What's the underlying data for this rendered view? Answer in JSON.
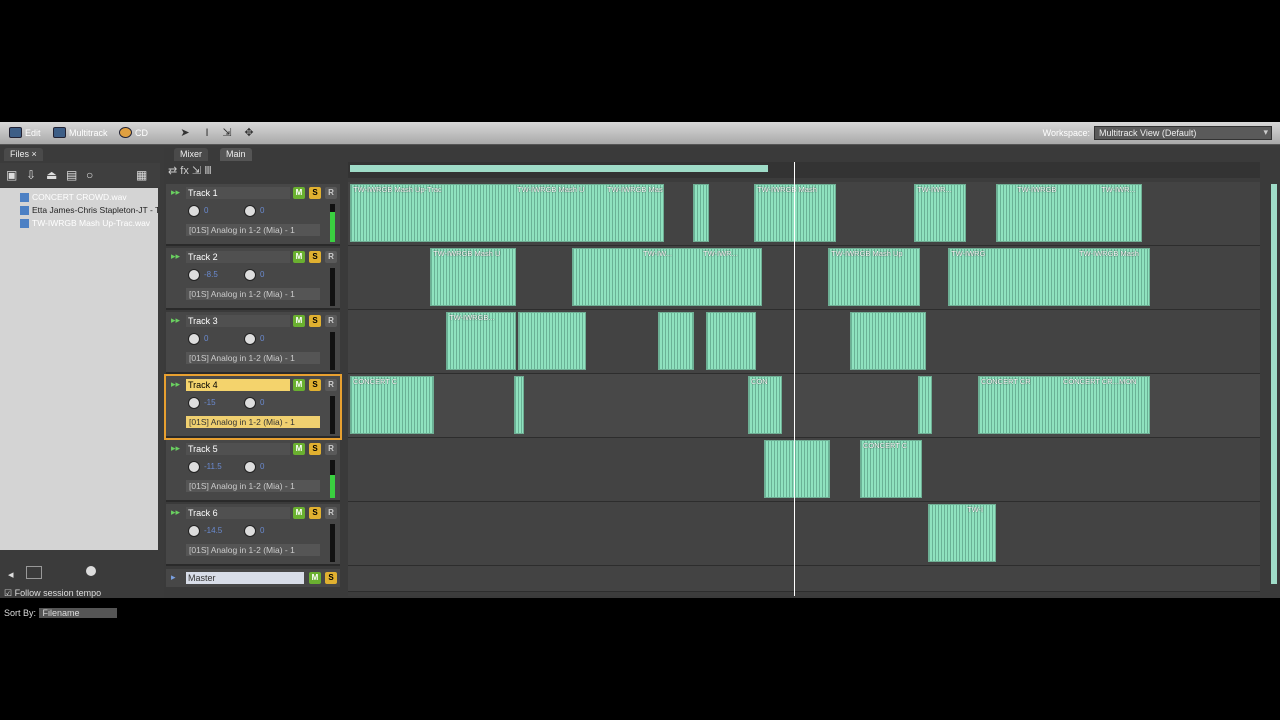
{
  "toolbar": {
    "edit_label": "Edit",
    "multitrack_label": "Multitrack",
    "cd_label": "CD",
    "workspace_label": "Workspace:",
    "workspace_value": "Multitrack View (Default)"
  },
  "files_panel": {
    "tab": "Files",
    "files": [
      "CONCERT CROWD.wav",
      "Etta James-Chris Stapleton-JT - T",
      "TW-IWRGB Mash Up-Trac.wav"
    ],
    "follow_tempo": "Follow session tempo",
    "sort_label": "Sort By:",
    "sort_value": "Filename"
  },
  "tabs": {
    "mixer": "Mixer",
    "main": "Main"
  },
  "tracks": [
    {
      "name": "Track 1",
      "vol": "0",
      "pan": "0",
      "input": "[01S] Analog in 1-2 (Mia) - 1"
    },
    {
      "name": "Track 2",
      "vol": "-8.5",
      "pan": "0",
      "input": "[01S] Analog in 1-2 (Mia) - 1"
    },
    {
      "name": "Track 3",
      "vol": "0",
      "pan": "0",
      "input": "[01S] Analog in 1-2 (Mia) - 1"
    },
    {
      "name": "Track 4",
      "vol": "-15",
      "pan": "0",
      "input": "[01S] Analog in 1-2 (Mia) - 1"
    },
    {
      "name": "Track 5",
      "vol": "-11.5",
      "pan": "0",
      "input": "[01S] Analog in 1-2 (Mia) - 1"
    },
    {
      "name": "Track 6",
      "vol": "-14.5",
      "pan": "0",
      "input": "[01S] Analog in 1-2 (Mia) - 1"
    }
  ],
  "master": {
    "name": "Master"
  },
  "buttons": {
    "m": "M",
    "s": "S",
    "r": "R"
  },
  "clips": {
    "t1a": "TW-IWRGB Mash Up-Trac",
    "t1b": "TW-IWRGB Mash U",
    "t1c": "TW-IWRGB Mash",
    "t1d": "TW-IWRGB Mash",
    "t1e": "TW-IWR...",
    "t1f": "TW-IWRGB",
    "t1g": "TW-IWR...",
    "t2a": "TW-IWRGB Mash U",
    "t2b": "TW-IW...",
    "t2c": "TW-IWR...",
    "t2d": "TW-IWRGB Mash Up",
    "t2e": "TW-IWRG",
    "t2f": "TW-IWRGB Mash",
    "t3a": "TW-IWRGB...",
    "t4a": "CONCERT C",
    "t4b": "CON",
    "t4c": "CONCERT CR",
    "t4d": "CONCERT CR...MON",
    "t5a": "CONCERT C",
    "t6a": "TW-I"
  }
}
